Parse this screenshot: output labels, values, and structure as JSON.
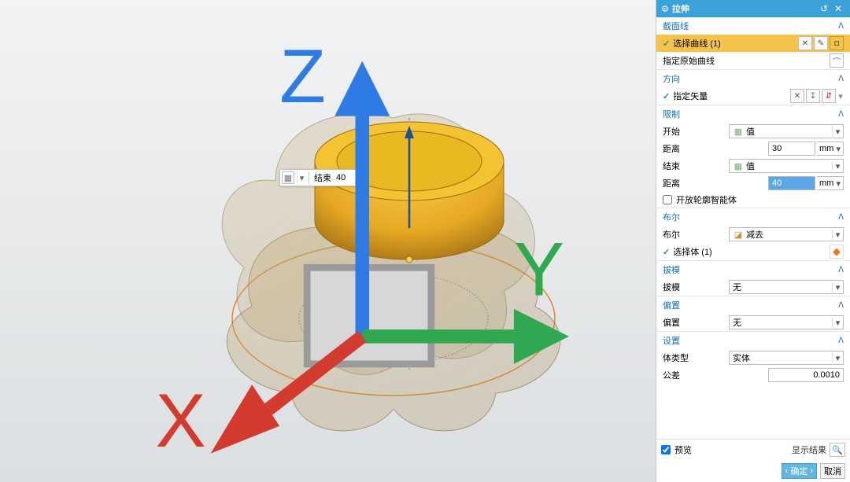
{
  "panel": {
    "title": "拉伸",
    "sections": {
      "section_curve": {
        "title": "截面线",
        "select_curve": {
          "label": "选择曲线 (1)"
        },
        "orig_curve_label": "指定原始曲线"
      },
      "direction": {
        "title": "方向",
        "vector": {
          "label": "指定矢量"
        }
      },
      "limits": {
        "title": "限制",
        "start_label": "开始",
        "start_option": "值",
        "start_dist_label": "距离",
        "start_dist_value": "30",
        "start_unit": "mm",
        "end_label": "结束",
        "end_option": "值",
        "end_dist_label": "距离",
        "end_dist_value": "40",
        "end_unit": "mm",
        "open_profile_label": "开放轮廓智能体"
      },
      "boolean": {
        "title": "布尔",
        "bool_label": "布尔",
        "bool_option": "减去",
        "select_body": {
          "label": "选择体 (1)"
        }
      },
      "draft": {
        "title": "拔模",
        "label": "拔模",
        "option": "无"
      },
      "offset": {
        "title": "偏置",
        "label": "偏置",
        "option": "无"
      },
      "settings": {
        "title": "设置",
        "body_type_label": "体类型",
        "body_type_option": "实体",
        "tol_label": "公差",
        "tol_value": "0.0010"
      }
    },
    "footer": {
      "preview_label": "预览",
      "show_result_label": "显示结果"
    },
    "actions": {
      "ok": "确定",
      "cancel": "取消"
    }
  },
  "floating": {
    "label": "结束",
    "value": "40"
  },
  "triad": {
    "x": "X",
    "y": "Y",
    "z": "Z"
  }
}
